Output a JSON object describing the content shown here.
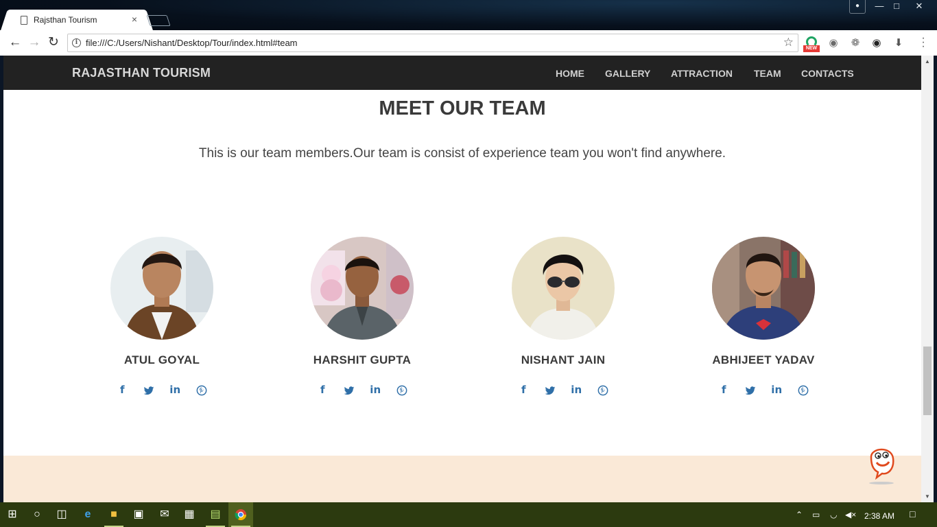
{
  "browser": {
    "tab_title": "Rajsthan Tourism",
    "tab_close": "×",
    "url": "file:///C:/Users/Nishant/Desktop/Tour/index.html#team",
    "ext_new_badge": "NEW"
  },
  "page": {
    "brand": "RAJASTHAN TOURISM",
    "nav": [
      "HOME",
      "GALLERY",
      "ATTRACTION",
      "TEAM",
      "CONTACTS"
    ],
    "team_heading": "MEET OUR TEAM",
    "team_subtitle": "This is our team members.Our team is consist of experience team you won't find anywhere.",
    "members": [
      {
        "name": "ATUL GOYAL"
      },
      {
        "name": "HARSHIT GUPTA"
      },
      {
        "name": "NISHANT JAIN"
      },
      {
        "name": "ABHIJEET YADAV"
      }
    ],
    "social_icons": [
      "facebook-icon",
      "twitter-icon",
      "linkedin-icon",
      "pinterest-icon"
    ],
    "accent_color": "#2f6fa8",
    "next_section_color": "#fae9d7"
  },
  "taskbar": {
    "clock": "2:38 AM"
  }
}
